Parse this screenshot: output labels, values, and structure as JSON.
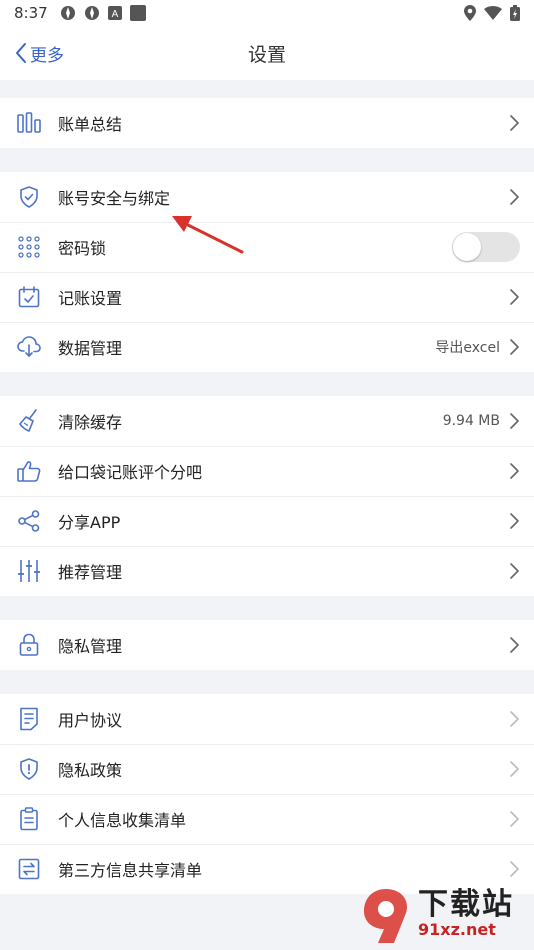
{
  "status_bar": {
    "time": "8:37"
  },
  "nav": {
    "back_label": "更多",
    "title": "设置"
  },
  "groups": [
    {
      "items": [
        {
          "label": "账单总结",
          "icon": "bar-chart-icon"
        }
      ]
    },
    {
      "items": [
        {
          "label": "账号安全与绑定",
          "icon": "shield-check-icon"
        },
        {
          "label": "密码锁",
          "icon": "keypad-icon",
          "toggle": false
        },
        {
          "label": "记账设置",
          "icon": "calendar-check-icon"
        },
        {
          "label": "数据管理",
          "icon": "cloud-download-icon",
          "value": "导出excel"
        }
      ]
    },
    {
      "items": [
        {
          "label": "清除缓存",
          "icon": "broom-icon",
          "value": "9.94 MB"
        },
        {
          "label": "给口袋记账评个分吧",
          "icon": "thumbs-up-icon"
        },
        {
          "label": "分享APP",
          "icon": "share-icon"
        },
        {
          "label": "推荐管理",
          "icon": "sliders-icon"
        }
      ]
    },
    {
      "items": [
        {
          "label": "隐私管理",
          "icon": "lock-icon"
        }
      ]
    },
    {
      "items": [
        {
          "label": "用户协议",
          "icon": "document-icon"
        },
        {
          "label": "隐私政策",
          "icon": "shield-info-icon"
        },
        {
          "label": "个人信息收集清单",
          "icon": "clipboard-icon"
        },
        {
          "label": "第三方信息共享清单",
          "icon": "exchange-icon"
        }
      ]
    }
  ],
  "watermark": {
    "main": "下载站",
    "sub": "91xz.net",
    "logo": "9f"
  },
  "colors": {
    "accent": "#3a62c8",
    "icon": "#4d74c9",
    "annotation": "#d9322b"
  }
}
